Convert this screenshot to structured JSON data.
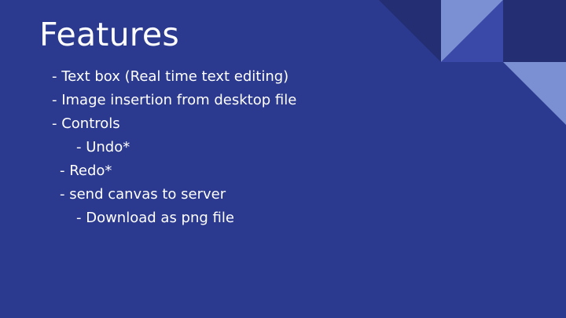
{
  "slide": {
    "title": "Features",
    "bullets": [
      "- Text box (Real time text editing)",
      "- Image insertion from desktop file",
      "- Controls",
      "- Undo*",
      "- Redo*",
      "- send canvas to server",
      "- Download as png file"
    ]
  },
  "colors": {
    "background": "#2b3a8f",
    "triangle_dark": "#232e73",
    "triangle_light": "#7b8fd3",
    "triangle_mid": "#3a49a8",
    "text": "#ffffff"
  }
}
